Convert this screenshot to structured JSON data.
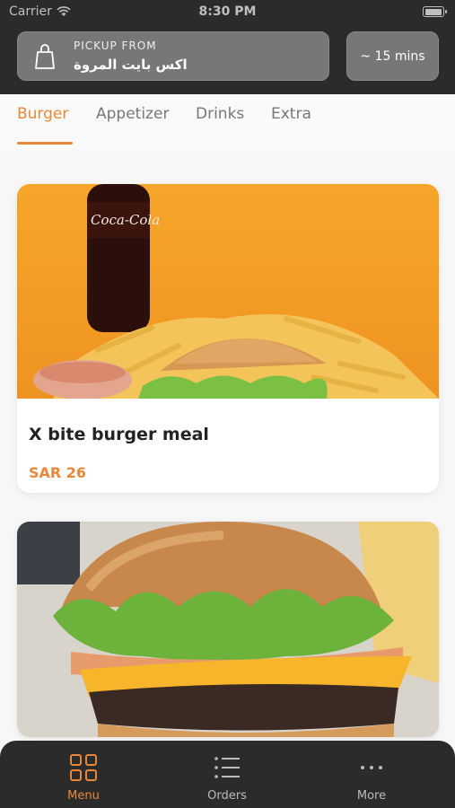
{
  "status_bar": {
    "carrier": "Carrier",
    "time": "8:30 PM"
  },
  "header": {
    "pickup_label": "PICKUP FROM",
    "pickup_location": "اكس بايت المروة",
    "eta": "~ 15 mins"
  },
  "tabs": [
    {
      "label": "Burger",
      "active": true
    },
    {
      "label": "Appetizer",
      "active": false
    },
    {
      "label": "Drinks",
      "active": false
    },
    {
      "label": "Extra",
      "active": false
    }
  ],
  "menu_items": [
    {
      "title": "X bite burger meal",
      "price": "SAR 26"
    },
    {
      "title": "",
      "price": ""
    }
  ],
  "bottom_nav": [
    {
      "label": "Menu",
      "icon": "grid-icon",
      "active": true
    },
    {
      "label": "Orders",
      "icon": "list-icon",
      "active": false
    },
    {
      "label": "More",
      "icon": "more-icon",
      "active": false
    }
  ],
  "colors": {
    "accent": "#e8873a",
    "header_bg": "#2b2b2b",
    "pill_bg": "#777777"
  }
}
